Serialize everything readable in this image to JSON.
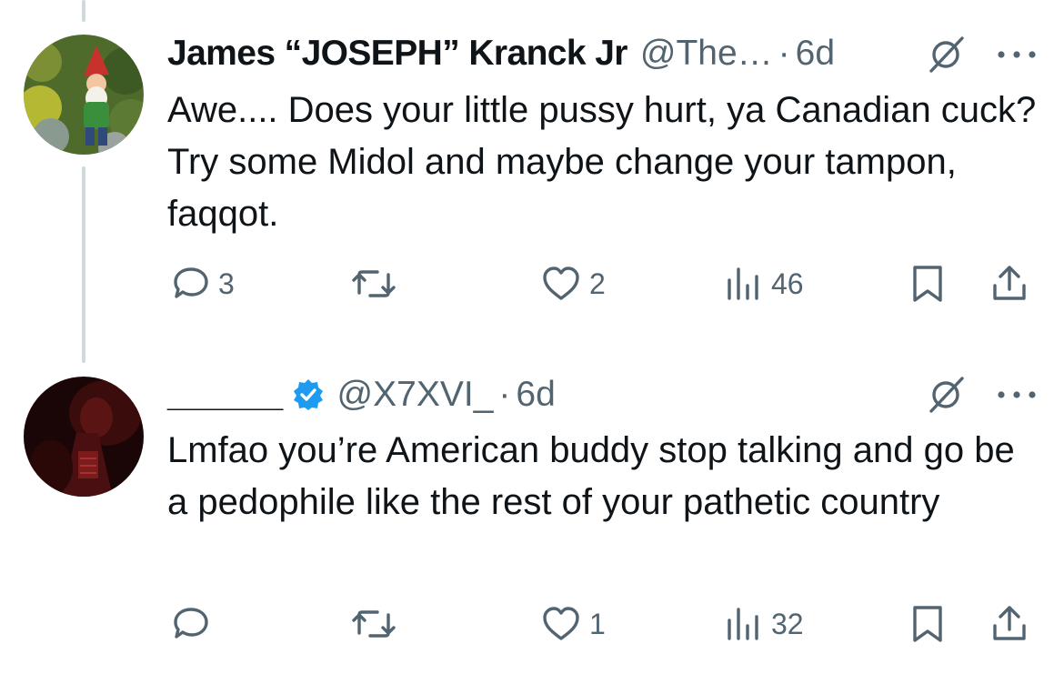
{
  "tweets": [
    {
      "name": "James “JOSEPH” Kranck Jr",
      "handle": "@The…",
      "time": "6d",
      "verified": false,
      "text": "Awe.... Does your little pussy hurt, ya Canadian cuck? Try some Midol and maybe change your tampon, faqqot.",
      "replies": "3",
      "reposts": "",
      "likes": "2",
      "views": "46",
      "avatar_icon": "gnome-avatar"
    },
    {
      "name": "______",
      "handle": "@X7XVI_",
      "time": "6d",
      "verified": true,
      "text": "Lmfao you’re American buddy stop talking and go be a pedophile like the rest of your pathetic country",
      "replies": "",
      "reposts": "",
      "likes": "1",
      "views": "32",
      "avatar_icon": "dark-red-avatar"
    }
  ],
  "dot": "·",
  "colors": {
    "text": "#0f1419",
    "secondary": "#536471",
    "verified": "#1d9bf0",
    "thread_line": "#cfd9de"
  }
}
